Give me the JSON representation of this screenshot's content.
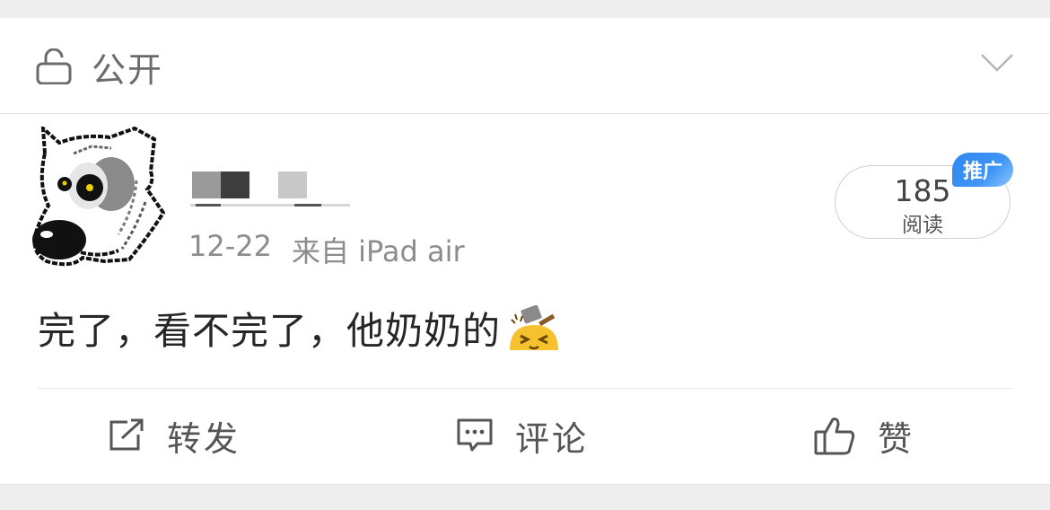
{
  "privacy": {
    "label": "公开",
    "icon": "lock-open-icon"
  },
  "dropdown": {
    "icon": "chevron-down-icon"
  },
  "post": {
    "meta": {
      "date": "12-22",
      "source": "来自 iPad air"
    },
    "read": {
      "count": "185",
      "label": "阅读",
      "tag": "推广"
    },
    "text": "完了，看不完了，他奶奶的",
    "emoji": "hammer-face-icon"
  },
  "actions": [
    {
      "label": "转发",
      "icon": "repost-icon"
    },
    {
      "label": "评论",
      "icon": "comment-icon"
    },
    {
      "label": "赞",
      "icon": "thumbs-up-icon"
    }
  ],
  "colors": {
    "accent": "#2f86f0",
    "text": "#262626",
    "muted": "#8c8c8c",
    "background": "#eeeeee"
  }
}
